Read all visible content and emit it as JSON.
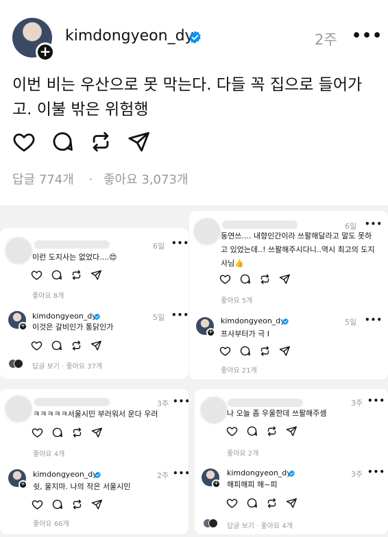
{
  "post": {
    "username": "kimdongyeon_dy",
    "time": "2주",
    "more": "•••",
    "text": "이번 비는 우산으로 못 막는다. 다들 꼭 집으로 들어가고. 이불 밖은 위험행",
    "replies": "답글 774개",
    "dot": "·",
    "likes": "좋아요 3,073개"
  },
  "cards": [
    {
      "comment_time": "6일",
      "comment_text": "이런 도지사는 없었다....😍",
      "comment_likes": "좋아요 8개",
      "reply_name": "kimdongyeon_dy",
      "reply_time": "5일",
      "reply_text": "이것은 갈비인가 통닭인가",
      "footer": "답글 보기 · 좋아요 37개"
    },
    {
      "comment_time": "6일",
      "comment_text": "동연쓰.... 내향인간이라 쓰팔해달라고 말도 못하고 있었는데..! 쓰팔해주시다니..역시 최고의 도지사님👍",
      "comment_likes": "좋아요 5개",
      "reply_name": "kimdongyeon_dy",
      "reply_time": "5일",
      "reply_text": "프사부터가 극 I",
      "reply_likes": "좋아요 21개"
    },
    {
      "comment_time": "3주",
      "comment_text": "ㅋㅋㅋㅋㅋ서울시민 부러워서 운다 우러",
      "comment_likes": "좋아요 4개",
      "reply_name": "kimdongyeon_dy",
      "reply_time": "2주",
      "reply_text": "쉿, 울지마. 나의 작은 서울시민",
      "reply_likes": "좋아요 66개"
    },
    {
      "comment_time": "3주",
      "comment_text": "나 오늘 좀 우울한데 쓰팔해주셈",
      "comment_likes": "좋아요 2개",
      "reply_name": "kimdongyeon_dy",
      "reply_time": "3주",
      "reply_text": "해피해피 해~피",
      "footer": "답글 보기 · 좋아요 4개"
    }
  ],
  "colors": {
    "verified": "#0095f6",
    "muted": "#999999"
  }
}
